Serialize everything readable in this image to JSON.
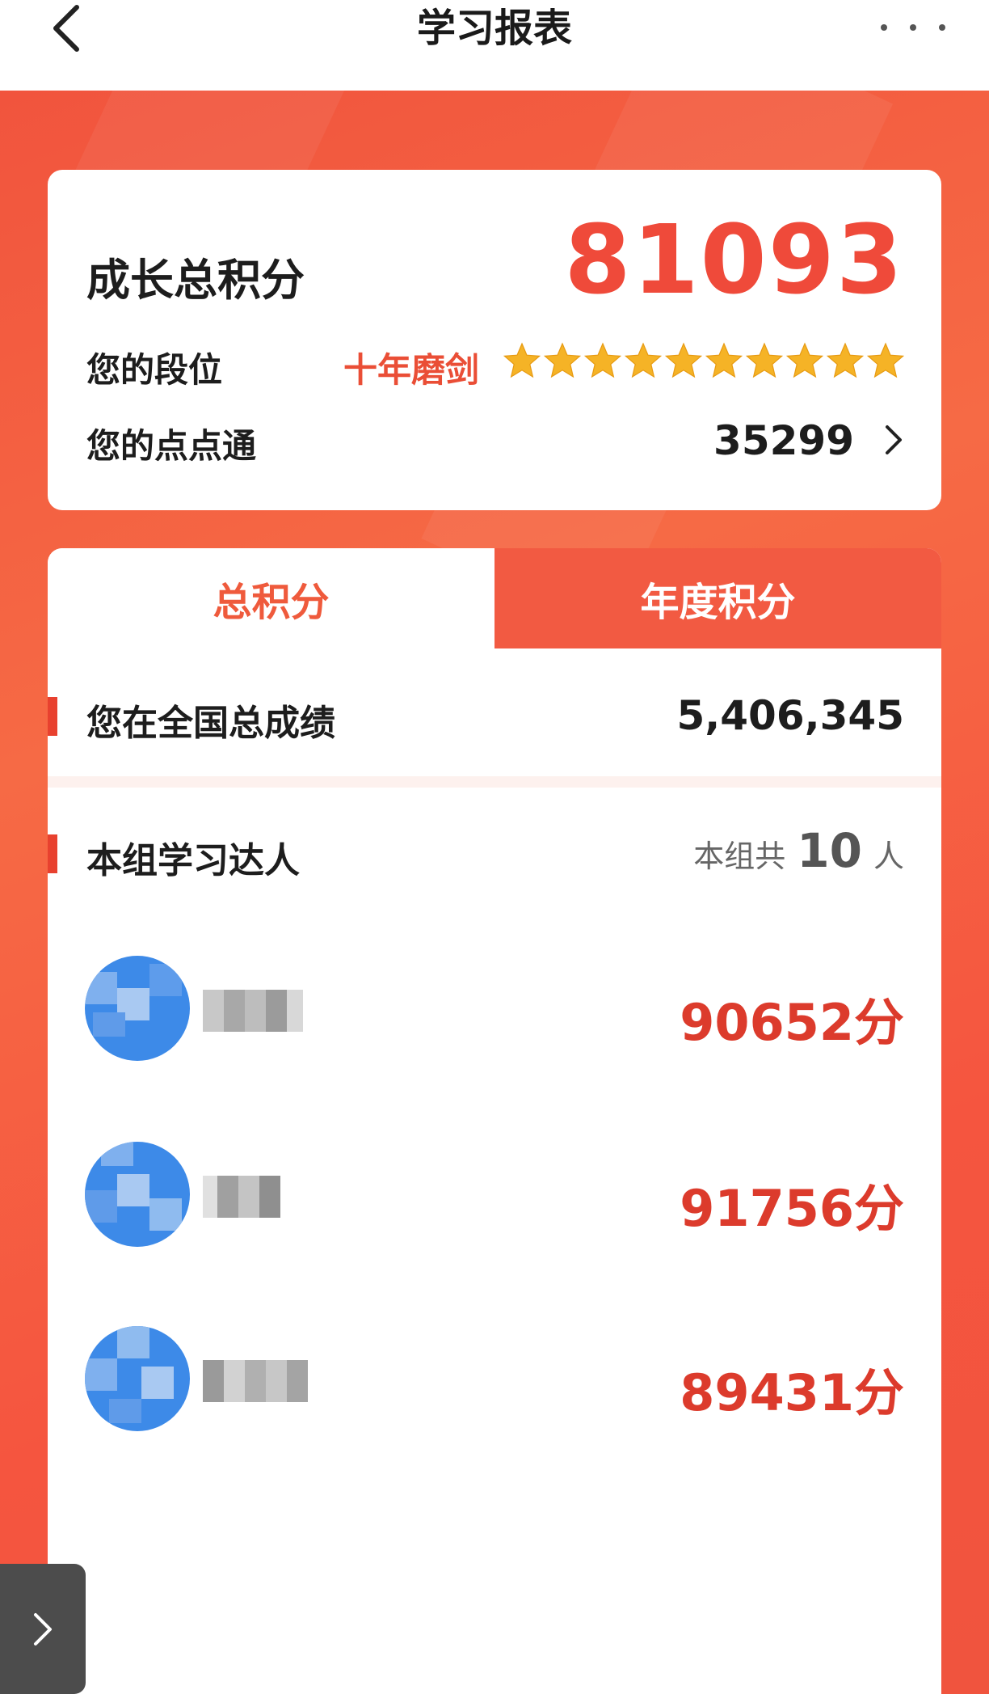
{
  "nav": {
    "title": "学习报表",
    "back_icon": "chevron-left-icon",
    "more_icon": "more-dots-icon"
  },
  "summary": {
    "total_label": "成长总积分",
    "total_value": "81093",
    "rank_label": "您的段位",
    "rank_name": "十年磨剑",
    "stars": 10,
    "star_color": "#f5b326",
    "points_label": "您的点点通",
    "points_value": "35299"
  },
  "tabs": [
    {
      "label": "总积分",
      "active": false
    },
    {
      "label": "年度积分",
      "active": true
    }
  ],
  "national": {
    "label": "您在全国总成绩",
    "value": "5,406,345"
  },
  "group": {
    "label": "本组学习达人",
    "count_prefix": "本组共",
    "count": "10",
    "count_suffix": "人",
    "members": [
      {
        "score": "90652分"
      },
      {
        "score": "91756分"
      },
      {
        "score": "89431分"
      }
    ]
  },
  "colors": {
    "accent": "#ef4a3a",
    "tab_active_bg": "#f25a42",
    "avatar_blue": "#3d8ae8"
  }
}
